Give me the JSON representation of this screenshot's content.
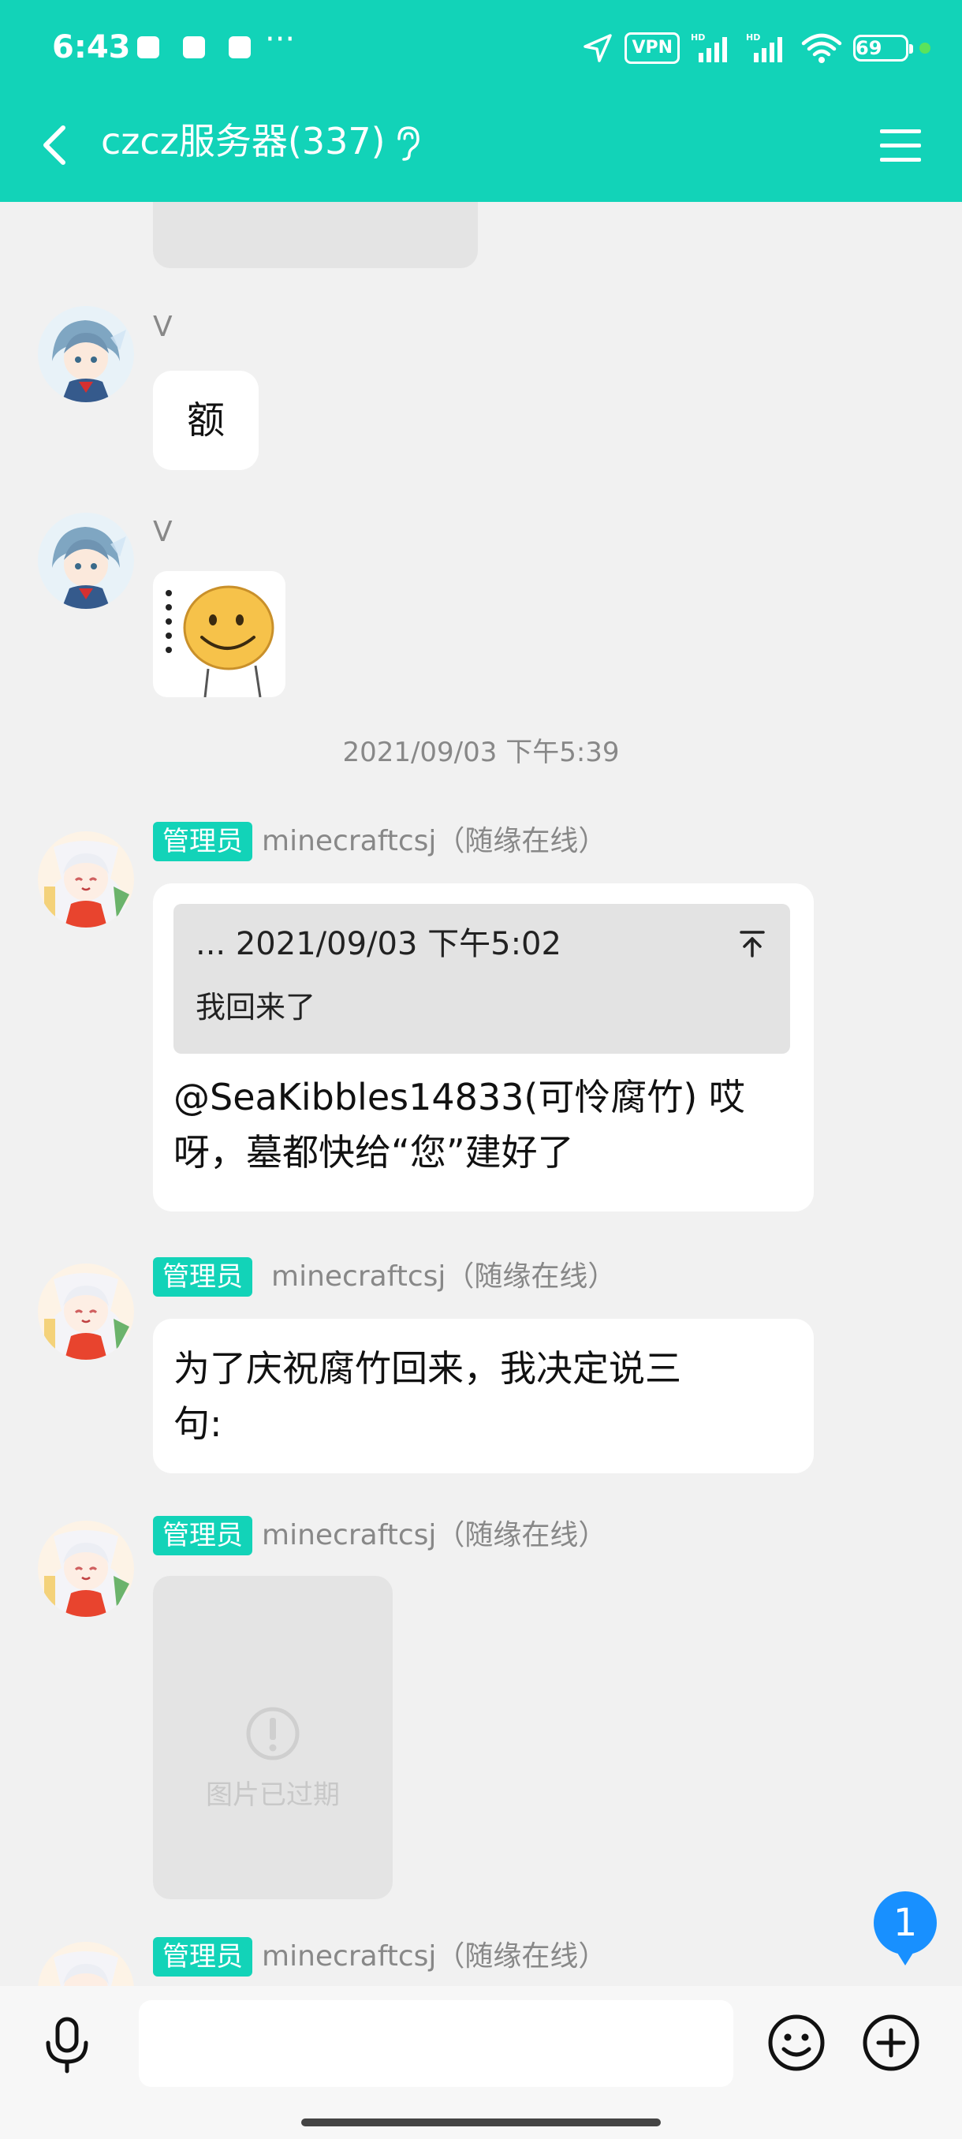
{
  "status_bar": {
    "time": "6:43",
    "more": "···",
    "vpn": "VPN",
    "battery": "69"
  },
  "header": {
    "title": "czcz服务器(337)"
  },
  "messages": [
    {
      "sender": "V",
      "text": "额"
    },
    {
      "sender": "V",
      "sticker": "smiley-face-sticker"
    },
    {
      "timestamp": "2021/09/03 下午5:39"
    },
    {
      "badge": "管理员",
      "sender": "minecraftcsj（随缘在线）",
      "quote": {
        "header": "... 2021/09/03 下午5:02",
        "text": "我回来了"
      },
      "text_line1": "@SeaKibbles14833(可怜腐竹) 哎",
      "text_line2": "呀，墓都快给“您”建好了"
    },
    {
      "badge": "管理员",
      "sender": "minecraftcsj（随缘在线）",
      "text_line1": "为了庆祝腐竹回来，我决定说三",
      "text_line2": "句:"
    },
    {
      "badge": "管理员",
      "sender": "minecraftcsj（随缘在线）",
      "expired_image_text": "图片已过期"
    },
    {
      "badge": "管理员",
      "sender": "minecraftcsj（随缘在线）"
    }
  ],
  "unread_count": "1",
  "input": {
    "placeholder": ""
  },
  "colors": {
    "accent": "#12d3b8",
    "badge_blue": "#1890ff",
    "background": "#f1f1f1"
  }
}
